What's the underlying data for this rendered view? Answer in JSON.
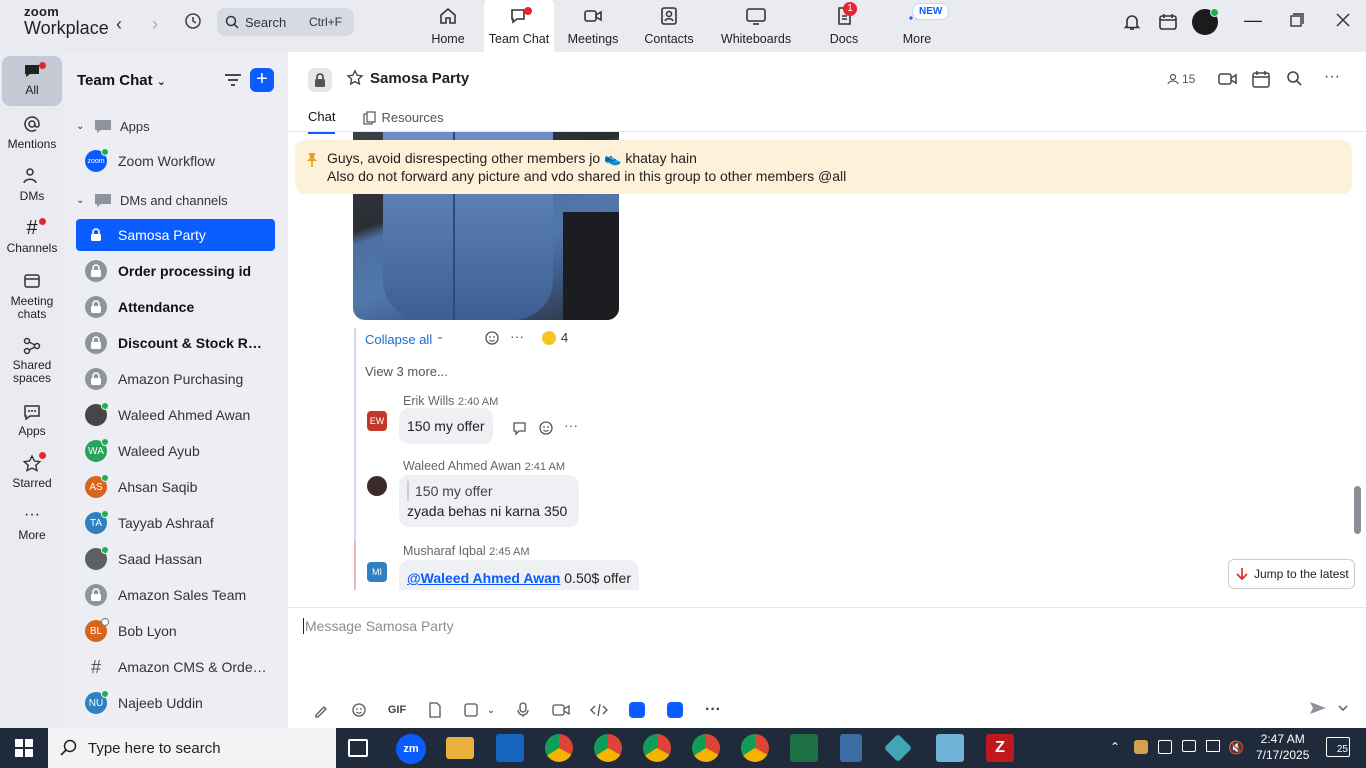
{
  "app": {
    "brand_top": "zoom",
    "brand_bottom": "Workplace"
  },
  "search": {
    "label": "Search",
    "shortcut": "Ctrl+F"
  },
  "topnav": [
    {
      "label": "Home"
    },
    {
      "label": "Team Chat"
    },
    {
      "label": "Meetings"
    },
    {
      "label": "Contacts"
    },
    {
      "label": "Whiteboards"
    },
    {
      "label": "Docs",
      "badge": "1"
    },
    {
      "label": "More",
      "tag": "NEW"
    }
  ],
  "rail": [
    {
      "label": "All"
    },
    {
      "label": "Mentions"
    },
    {
      "label": "DMs"
    },
    {
      "label": "Channels"
    },
    {
      "label": "Meeting chats"
    },
    {
      "label": "Shared spaces"
    },
    {
      "label": "Apps"
    },
    {
      "label": "Starred"
    },
    {
      "label": "More"
    }
  ],
  "sidebar": {
    "title": "Team Chat",
    "sections": [
      {
        "label": "Apps"
      },
      {
        "label": "DMs and channels"
      }
    ],
    "apps": [
      {
        "label": "Zoom Workflow",
        "icon": "zoom"
      }
    ],
    "items": [
      {
        "label": "Samosa Party",
        "initials": "",
        "color": "#8f939c"
      },
      {
        "label": "Order processing id",
        "initials": "",
        "color": "#8f939c"
      },
      {
        "label": "Attendance",
        "initials": "",
        "color": "#8f939c"
      },
      {
        "label": "Discount & Stock Res...",
        "initials": "",
        "color": "#8f939c"
      },
      {
        "label": "Amazon Purchasing",
        "initials": "",
        "color": "#8f939c"
      },
      {
        "label": "Waleed Ahmed Awan",
        "initials": "",
        "color": "#4a4545"
      },
      {
        "label": "Waleed Ayub",
        "initials": "WA",
        "color": "#27a35b"
      },
      {
        "label": "Ahsan Saqib",
        "initials": "AS",
        "color": "#d9641e"
      },
      {
        "label": "Tayyab Ashraaf",
        "initials": "TA",
        "color": "#2f7fc1"
      },
      {
        "label": "Saad Hassan",
        "initials": "",
        "color": "#5b5f66"
      },
      {
        "label": "Amazon Sales Team",
        "initials": "",
        "color": "#8f939c"
      },
      {
        "label": "Bob Lyon",
        "initials": "BL",
        "color": "#d9641e"
      },
      {
        "label": "Amazon CMS & OrderA...",
        "initials": "#",
        "color": "transparent"
      },
      {
        "label": "Najeeb Uddin",
        "initials": "NU",
        "color": "#2f7fc1"
      }
    ]
  },
  "channel": {
    "name": "Samosa Party",
    "members": "15",
    "tabs": [
      {
        "label": "Chat"
      },
      {
        "label": "Resources"
      }
    ]
  },
  "pinned": {
    "line1": "Guys, avoid disrespecting other members jo 👟 khatay hain",
    "line2": "Also do not forward any picture and vdo shared in this group to other members @all"
  },
  "thread": {
    "collapse": "Collapse all",
    "reaction_count": "4",
    "view_more": "View 3 more..."
  },
  "messages": [
    {
      "initials": "EW",
      "color": "#c0392b",
      "sender": "Erik Wills",
      "time": "2:40 AM",
      "text": "150 my offer"
    },
    {
      "initials": "",
      "color": "#3a2a2a",
      "sender": "Waleed Ahmed Awan",
      "time": "2:41 AM",
      "quote": "150 my offer",
      "text": "zyada behas ni karna 350"
    },
    {
      "initials": "MI",
      "color": "#2f7fc1",
      "sender": "Musharaf Iqbal",
      "time": "2:45 AM",
      "mention": "@Waleed Ahmed Awan",
      "text": " 0.50$ offer"
    }
  ],
  "jump_label": "Jump to the latest",
  "composer": {
    "placeholder": "Message Samosa Party"
  },
  "tools": [
    "GIF"
  ],
  "taskbar": {
    "search": "Type here to search",
    "time": "2:47 AM",
    "date": "7/17/2025",
    "notif": "25"
  }
}
